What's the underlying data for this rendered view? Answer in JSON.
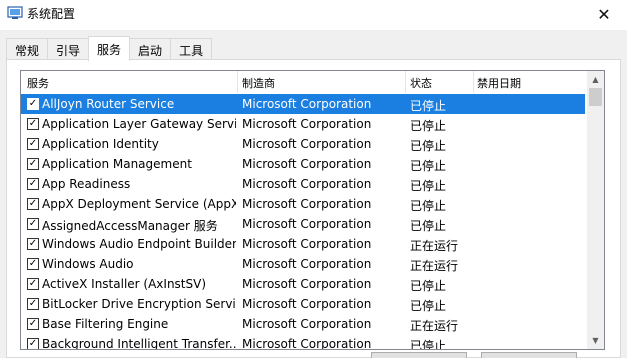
{
  "window": {
    "title": "系统配置",
    "close_glyph": "✕"
  },
  "tabs": [
    {
      "label": "常规"
    },
    {
      "label": "引导"
    },
    {
      "label": "服务"
    },
    {
      "label": "启动"
    },
    {
      "label": "工具"
    }
  ],
  "active_tab": "服务",
  "table": {
    "columns": [
      "服务",
      "制造商",
      "状态",
      "禁用日期"
    ],
    "rows": [
      {
        "name": "AllJoyn Router Service",
        "maker": "Microsoft Corporation",
        "status": "已停止",
        "checked": true,
        "selected": true
      },
      {
        "name": "Application Layer Gateway Service",
        "maker": "Microsoft Corporation",
        "status": "已停止",
        "checked": true
      },
      {
        "name": "Application Identity",
        "maker": "Microsoft Corporation",
        "status": "已停止",
        "checked": true
      },
      {
        "name": "Application Management",
        "maker": "Microsoft Corporation",
        "status": "已停止",
        "checked": true
      },
      {
        "name": "App Readiness",
        "maker": "Microsoft Corporation",
        "status": "已停止",
        "checked": true
      },
      {
        "name": "AppX Deployment Service (AppX...",
        "maker": "Microsoft Corporation",
        "status": "已停止",
        "checked": true
      },
      {
        "name": "AssignedAccessManager 服务",
        "maker": "Microsoft Corporation",
        "status": "已停止",
        "checked": true
      },
      {
        "name": "Windows Audio Endpoint Builder",
        "maker": "Microsoft Corporation",
        "status": "正在运行",
        "checked": true
      },
      {
        "name": "Windows Audio",
        "maker": "Microsoft Corporation",
        "status": "正在运行",
        "checked": true
      },
      {
        "name": "ActiveX Installer (AxInstSV)",
        "maker": "Microsoft Corporation",
        "status": "已停止",
        "checked": true
      },
      {
        "name": "BitLocker Drive Encryption Service",
        "maker": "Microsoft Corporation",
        "status": "已停止",
        "checked": true
      },
      {
        "name": "Base Filtering Engine",
        "maker": "Microsoft Corporation",
        "status": "正在运行",
        "checked": true
      },
      {
        "name": "Background Intelligent Transfer...",
        "maker": "Microsoft Corporation",
        "status": "已停止",
        "checked": true
      }
    ]
  },
  "colors": {
    "selection": "#1a7fe0",
    "window_bg": "#f0f0f0"
  },
  "icons": {
    "checkmark": "✓",
    "scroll_up": "▲",
    "scroll_down": "▼"
  }
}
